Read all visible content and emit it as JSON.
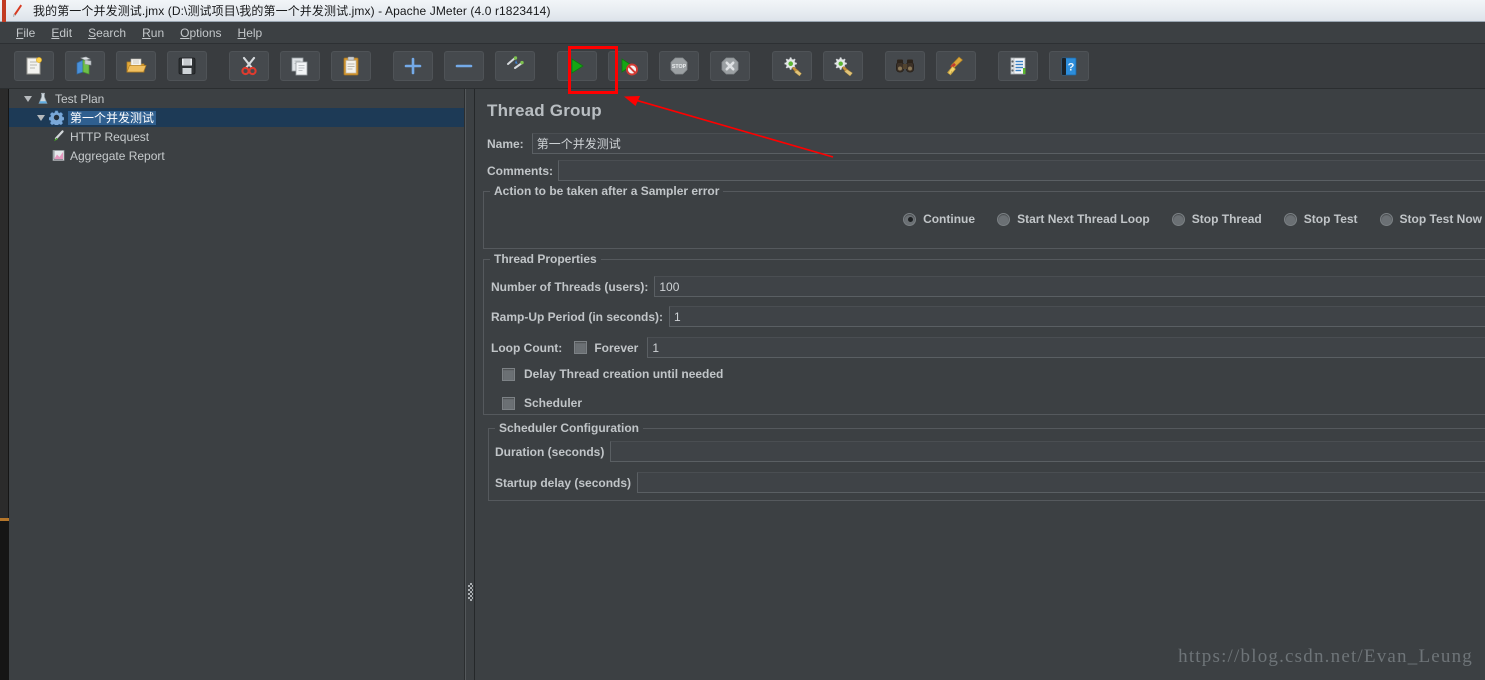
{
  "window": {
    "title": "我的第一个并发测试.jmx (D:\\测试项目\\我的第一个并发测试.jmx) - Apache JMeter (4.0 r1823414)",
    "app_icon": "jmeter-feather-icon"
  },
  "menubar": {
    "items": [
      {
        "label": "File",
        "mnemonic": "F"
      },
      {
        "label": "Edit",
        "mnemonic": "E"
      },
      {
        "label": "Search",
        "mnemonic": "S"
      },
      {
        "label": "Run",
        "mnemonic": "R"
      },
      {
        "label": "Options",
        "mnemonic": "O"
      },
      {
        "label": "Help",
        "mnemonic": "H"
      }
    ]
  },
  "toolbar": {
    "buttons": [
      {
        "name": "new-button",
        "icon": "new-document-icon",
        "gap_before": false
      },
      {
        "name": "templates-button",
        "icon": "templates-icon",
        "gap_before": false
      },
      {
        "name": "open-button",
        "icon": "open-folder-icon",
        "gap_before": false
      },
      {
        "name": "save-button",
        "icon": "save-floppy-icon",
        "gap_before": false
      },
      {
        "name": "cut-button",
        "icon": "scissors-icon",
        "gap_before": true
      },
      {
        "name": "copy-button",
        "icon": "copy-pages-icon",
        "gap_before": false
      },
      {
        "name": "paste-button",
        "icon": "clipboard-icon",
        "gap_before": false
      },
      {
        "name": "expand-all-button",
        "icon": "plus-icon",
        "gap_before": true
      },
      {
        "name": "collapse-all-button",
        "icon": "minus-icon",
        "gap_before": false
      },
      {
        "name": "toggle-button",
        "icon": "toggle-pencil-icon",
        "gap_before": false
      },
      {
        "name": "start-button",
        "icon": "green-play-icon",
        "gap_before": true
      },
      {
        "name": "start-no-pauses-button",
        "icon": "play-no-pause-icon",
        "gap_before": false
      },
      {
        "name": "stop-button",
        "icon": "stop-sign-icon",
        "gap_before": false
      },
      {
        "name": "shutdown-button",
        "icon": "shutdown-x-icon",
        "gap_before": false
      },
      {
        "name": "clear-button",
        "icon": "gear-broom-icon",
        "gap_before": true
      },
      {
        "name": "clear-all-button",
        "icon": "broom-gears-icon",
        "gap_before": false
      },
      {
        "name": "search-button",
        "icon": "binoculars-icon",
        "gap_before": true
      },
      {
        "name": "reset-search-button",
        "icon": "yellow-broom-icon",
        "gap_before": false
      },
      {
        "name": "function-helper-button",
        "icon": "notebook-list-icon",
        "gap_before": true
      },
      {
        "name": "help-button",
        "icon": "blue-help-book-icon",
        "gap_before": false
      }
    ]
  },
  "tree": {
    "nodes": [
      {
        "label": "Test Plan",
        "icon": "test-plan-icon",
        "indent": 0,
        "expanded": true,
        "has_toggle": true,
        "selected": false
      },
      {
        "label": "第一个并发测试",
        "icon": "thread-group-icon",
        "indent": 1,
        "expanded": true,
        "has_toggle": true,
        "selected": true
      },
      {
        "label": "HTTP Request",
        "icon": "http-request-icon",
        "indent": 2,
        "expanded": false,
        "has_toggle": false,
        "selected": false
      },
      {
        "label": "Aggregate Report",
        "icon": "aggregate-report-icon",
        "indent": 2,
        "expanded": false,
        "has_toggle": false,
        "selected": false
      }
    ]
  },
  "panel": {
    "title": "Thread Group",
    "name_label": "Name:",
    "name_value": "第一个并发测试",
    "comments_label": "Comments:",
    "comments_value": "",
    "sampler_error": {
      "legend": "Action to be taken after a Sampler error",
      "options": [
        {
          "label": "Continue",
          "selected": true
        },
        {
          "label": "Start Next Thread Loop",
          "selected": false
        },
        {
          "label": "Stop Thread",
          "selected": false
        },
        {
          "label": "Stop Test",
          "selected": false
        },
        {
          "label": "Stop Test Now",
          "selected": false
        }
      ]
    },
    "thread_properties": {
      "legend": "Thread Properties",
      "threads_label": "Number of Threads (users):",
      "threads_value": "100",
      "rampup_label": "Ramp-Up Period (in seconds):",
      "rampup_value": "1",
      "loop_label": "Loop Count:",
      "forever_label": "Forever",
      "forever_checked": false,
      "loop_value": "1",
      "delay_label": "Delay Thread creation until needed",
      "delay_checked": false,
      "scheduler_label": "Scheduler",
      "scheduler_checked": false
    },
    "scheduler_config": {
      "legend": "Scheduler Configuration",
      "duration_label": "Duration (seconds)",
      "duration_value": "",
      "startup_label": "Startup delay (seconds)",
      "startup_value": ""
    }
  },
  "annotations": {
    "highlight_target": "start-button",
    "color": "#fe0000"
  },
  "watermark": {
    "text": "https://blog.csdn.net/Evan_Leung"
  }
}
